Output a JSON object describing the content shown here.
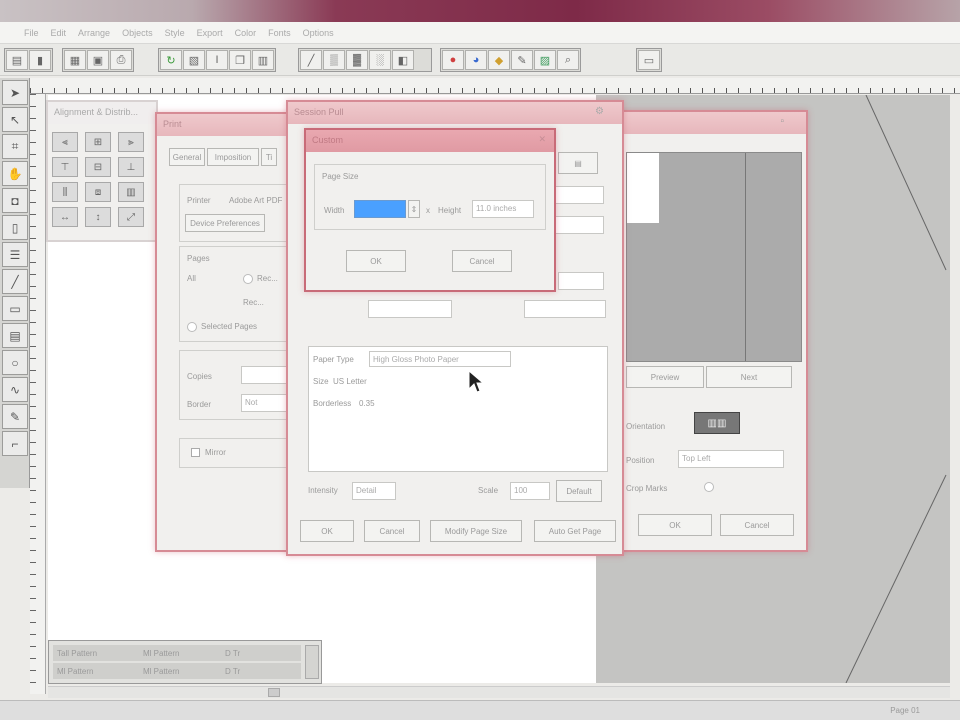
{
  "menu": [
    "File",
    "Edit",
    "Arrange",
    "Objects",
    "Style",
    "Export",
    "Color",
    "Fonts",
    "Options"
  ],
  "align_palette": {
    "title": "Alignment & Distrib..."
  },
  "print_dialog": {
    "title": "Print",
    "tabs": [
      "General",
      "Imposition",
      "Ti"
    ],
    "printer_label": "Printer",
    "printer_value": "Adobe Art PDF",
    "device_button": "Device Preferences",
    "pages_label": "Pages",
    "all_label": "All",
    "range_label": "Rec...",
    "selected_pages": "Selected Pages",
    "copies_label": "Copies",
    "border_label": "Border",
    "border_value": "Not",
    "mirror_label": "Mirror"
  },
  "page_setup_dialog": {
    "title": "Session Pull",
    "paper_type_label": "Paper Type",
    "paper_type_value": "High Gloss Photo Paper",
    "size_label": "Size",
    "size_value": "US Letter",
    "margins_label": "Borderless",
    "margins_value": "0.35",
    "intensity_label": "Intensity",
    "intensity_value": "Detail",
    "scale_label": "Scale",
    "scale_value": "100",
    "default_button": "Default",
    "ok": "OK",
    "cancel": "Cancel",
    "modify_button": "Modify Page Size",
    "auto_button": "Auto Get Page"
  },
  "custom_dialog": {
    "title": "Custom",
    "group_label": "Page Size",
    "width_label": "Width",
    "width_value": "",
    "x_sep": "x",
    "height_label": "Height",
    "height_value": "11.0 inches",
    "ok": "OK",
    "cancel": "Cancel"
  },
  "preview_dialog": {
    "preview_button": "Preview",
    "next_button": "Next",
    "orientation_label": "Orientation",
    "position_label": "Position",
    "position_value": "Top Left",
    "crop_label": "Crop Marks",
    "ok": "OK",
    "cancel": "Cancel"
  },
  "layers_panel": [
    {
      "name": "Tall Pattern",
      "col2": "Ml Pattern",
      "col3": "D Tr"
    },
    {
      "name": "Ml Pattern",
      "col2": "Ml Pattern",
      "col3": "D Tr"
    }
  ],
  "status": {
    "page": "Page 01"
  },
  "colors": {
    "accent": "#d68b95",
    "title_bar": "#e7b7bc",
    "highlight": "#4aa0ff"
  }
}
